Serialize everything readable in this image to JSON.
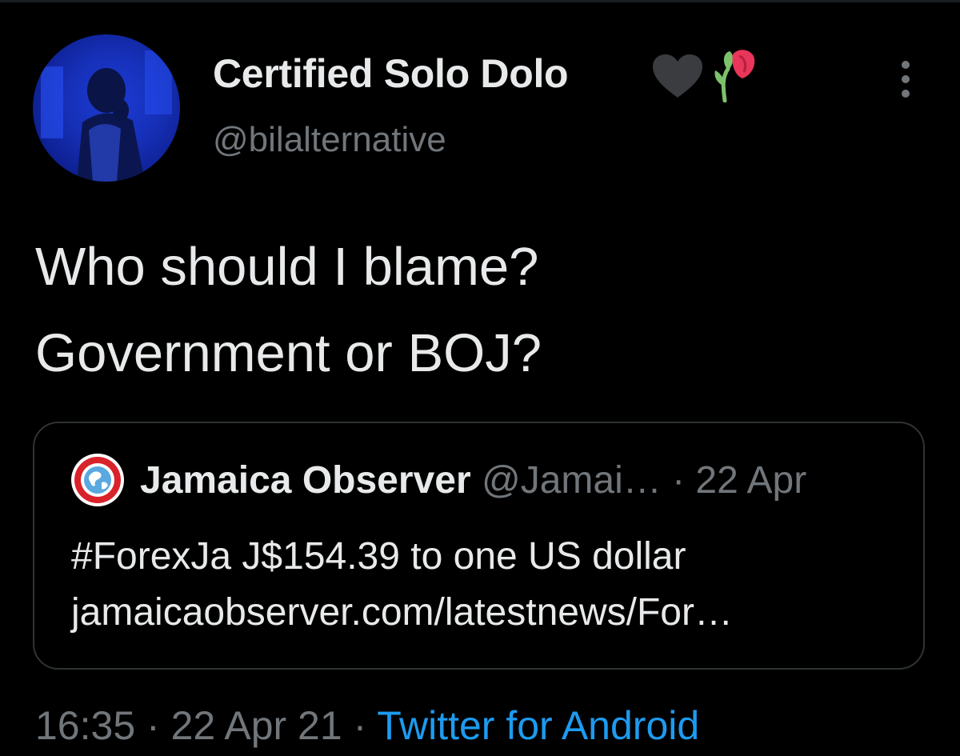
{
  "author": {
    "display_name": "Certified Solo Dolo",
    "handle": "@bilalternative",
    "avatar_icon": "profile-photo",
    "name_emojis": [
      "black-heart-icon",
      "wilted-flower-icon"
    ]
  },
  "tweet": {
    "lines": [
      "Who should I blame?",
      "Government or BOJ?"
    ]
  },
  "quoted_tweet": {
    "name": "Jamaica Observer",
    "handle": "@Jamai…",
    "separator": "·",
    "date": "22 Apr",
    "lines": [
      "#ForexJa J$154.39 to one US dollar",
      "jamaicaobserver.com/latestnews/For…"
    ]
  },
  "meta": {
    "time": "16:35",
    "sep1": "·",
    "date": "22 Apr 21",
    "sep2": "·",
    "source": "Twitter for Android"
  },
  "colors": {
    "background": "#000000",
    "text": "#e7e9ea",
    "muted": "#71767b",
    "link": "#1d9bf0",
    "border": "#2f3336"
  }
}
